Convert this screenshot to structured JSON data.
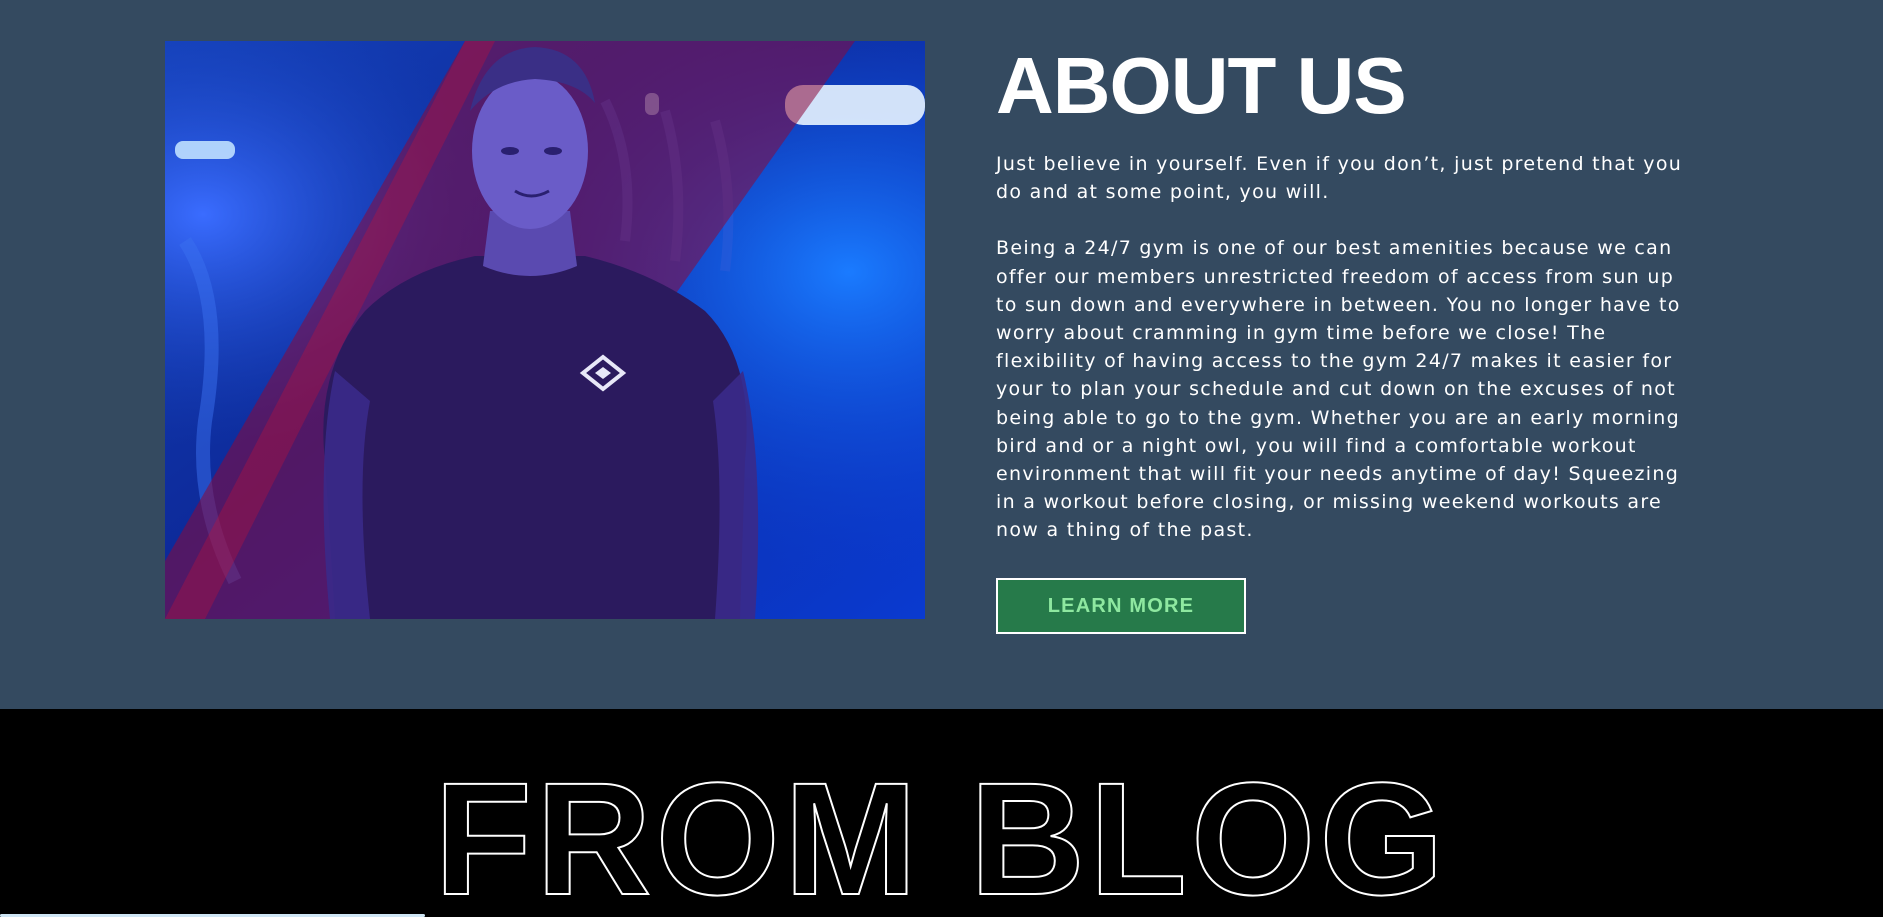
{
  "about": {
    "title": "ABOUT US",
    "paragraph_1": "Just believe in yourself. Even if you don’t, just pretend that you do and at some point, you will.",
    "paragraph_2": "Being a 24/7 gym is one of our best amenities because we can offer our members unrestricted freedom of access from sun up to sun down and everywhere in between. You no longer have to worry about cramming in gym time before we close! The flexibility of having access to the gym 24/7 makes it easier for your to plan your schedule and cut down on the excuses of not being able to go to the gym. Whether you are an early morning bird and or a night owl, you will find a comfortable workout environment that will fit your needs anytime of day! Squeezing in a workout before closing, or missing weekend workouts are now a thing of the past.",
    "button_label": "LEARN MORE",
    "photo_icon": "trainer-photo"
  },
  "blog": {
    "title": "FROM BLOG"
  },
  "colors": {
    "section_bg": "#344a60",
    "button_bg": "#267a4a",
    "button_text": "#8ee8a0",
    "blog_bg": "#000000"
  }
}
